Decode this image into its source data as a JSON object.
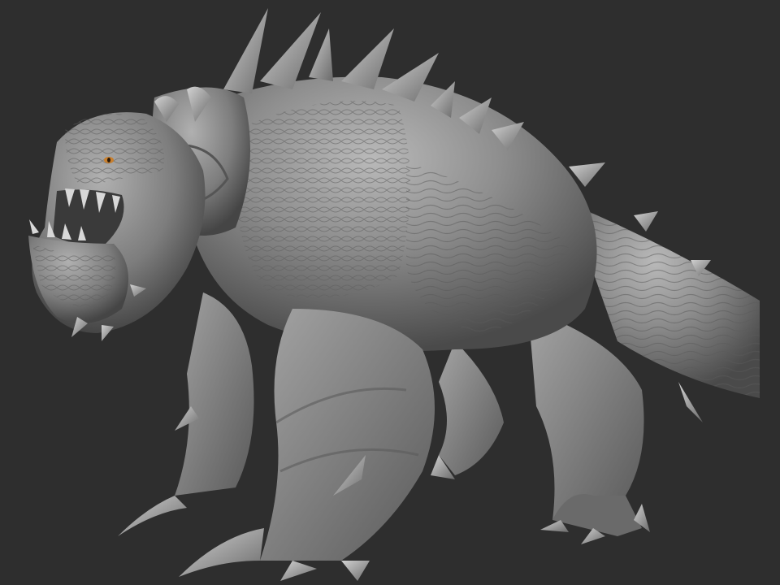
{
  "viewport": {
    "background": "#2e2e2e"
  },
  "model": {
    "subject": "creature-sculpt",
    "material": "matcap-gray",
    "eye_color": "#c87f2e",
    "base_color": "#8c8c8c"
  }
}
